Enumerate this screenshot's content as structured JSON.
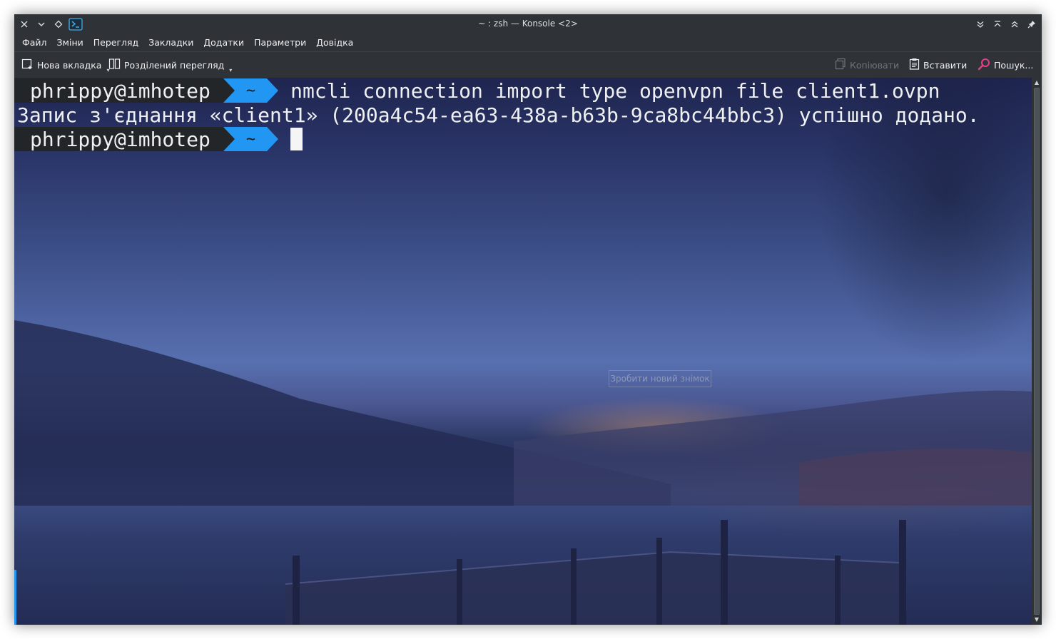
{
  "window": {
    "title": "~ : zsh — Konsole <2>"
  },
  "menubar": {
    "items": [
      "Файл",
      "Зміни",
      "Перегляд",
      "Закладки",
      "Додатки",
      "Параметри",
      "Довідка"
    ]
  },
  "toolbar": {
    "new_tab": "Нова вкладка",
    "split_view": "Розділений перегляд",
    "copy": "Копіювати",
    "paste": "Вставити",
    "search": "Пошук..."
  },
  "terminal": {
    "prompt_user": "phrippy@imhotep",
    "prompt_dir": "~",
    "command": "nmcli connection import type openvpn file client1.ovpn",
    "output": "Запис з'єднання «client1» (200a4c54-ea63-438a-b63b-9ca8bc44bbc3) успішно додано.",
    "snapshot_hint": "Зробити новий знімок"
  },
  "colors": {
    "prompt_user_bg": "#232629",
    "prompt_dir_bg": "#2196f3",
    "text": "#eff0f1",
    "chrome": "#2f3337"
  }
}
